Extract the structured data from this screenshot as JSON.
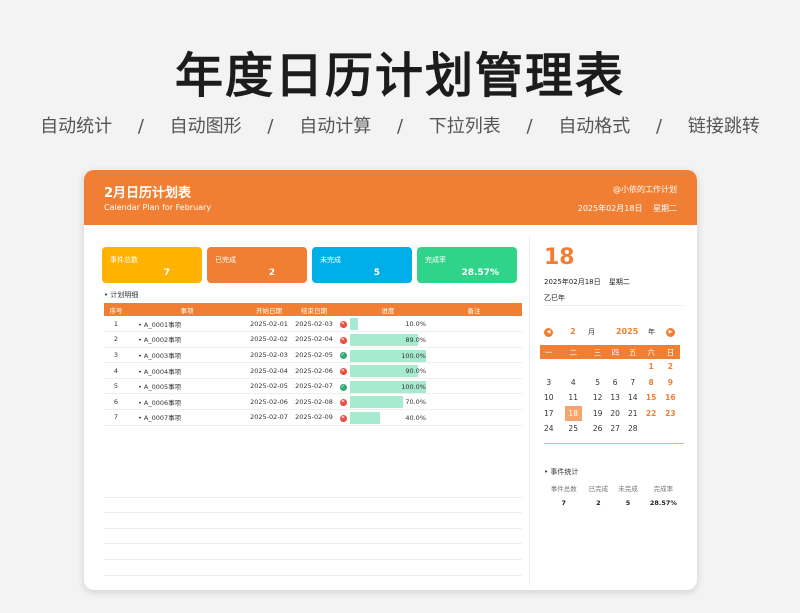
{
  "header": {
    "title": "年度日历计划管理表",
    "features": [
      "自动统计",
      "/",
      "自动图形",
      "/",
      "自动计算",
      "/",
      "下拉列表",
      "/",
      "自动格式",
      "/",
      "链接跳转"
    ]
  },
  "banner": {
    "title": "2月日历计划表",
    "subtitle": "Calendar Plan for February",
    "right_top": "@小依的工作计划",
    "right_bottom": "2025年02月18日    星期二"
  },
  "stats": [
    {
      "label": "事件总数",
      "value": "7",
      "color": "#ffb300"
    },
    {
      "label": "已完成",
      "value": "2",
      "color": "#f07f33"
    },
    {
      "label": "未完成",
      "value": "5",
      "color": "#00aee8"
    },
    {
      "label": "完成率",
      "value": "28.57%",
      "color": "#2fd48a"
    }
  ],
  "plan": {
    "section_label": "计划明细",
    "columns": [
      "序号",
      "事项",
      "开始日期",
      "结束日期",
      "进度",
      "",
      "备注"
    ],
    "rows": [
      {
        "no": "1",
        "item": "A_0001事项",
        "start": "2025-02-01",
        "end": "2025-02-03",
        "status": "x",
        "progress": 0.1,
        "pct": "10.0%"
      },
      {
        "no": "2",
        "item": "A_0002事项",
        "start": "2025-02-02",
        "end": "2025-02-04",
        "status": "x",
        "progress": 0.89,
        "pct": "89.0%"
      },
      {
        "no": "3",
        "item": "A_0003事项",
        "start": "2025-02-03",
        "end": "2025-02-05",
        "status": "ok",
        "progress": 1.0,
        "pct": "100.0%"
      },
      {
        "no": "4",
        "item": "A_0004事项",
        "start": "2025-02-04",
        "end": "2025-02-06",
        "status": "x",
        "progress": 0.9,
        "pct": "90.0%"
      },
      {
        "no": "5",
        "item": "A_0005事项",
        "start": "2025-02-05",
        "end": "2025-02-07",
        "status": "ok",
        "progress": 1.0,
        "pct": "100.0%"
      },
      {
        "no": "6",
        "item": "A_0006事项",
        "start": "2025-02-06",
        "end": "2025-02-08",
        "status": "x",
        "progress": 0.7,
        "pct": "70.0%"
      },
      {
        "no": "7",
        "item": "A_0007事项",
        "start": "2025-02-07",
        "end": "2025-02-09",
        "status": "x",
        "progress": 0.4,
        "pct": "40.0%"
      }
    ]
  },
  "sidebar": {
    "big_day": "18",
    "date_text": "2025年02月18日   星期二",
    "lunar": "乙巳年",
    "nav": {
      "prev": "◀",
      "next": "▶",
      "month": "2",
      "month_unit": "月",
      "year": "2025",
      "year_unit": "年"
    },
    "weekdays": [
      "一",
      "二",
      "三",
      "四",
      "五",
      "六",
      "日"
    ],
    "weeks": [
      [
        "",
        "",
        "",
        "",
        "",
        "1",
        "2"
      ],
      [
        "3",
        "4",
        "5",
        "6",
        "7",
        "8",
        "9"
      ],
      [
        "10",
        "11",
        "12",
        "13",
        "14",
        "15",
        "16"
      ],
      [
        "17",
        "18",
        "19",
        "20",
        "21",
        "22",
        "23"
      ],
      [
        "24",
        "25",
        "26",
        "27",
        "28",
        "",
        ""
      ]
    ],
    "today": "18",
    "event_stats": {
      "title": "事件统计",
      "headers": [
        "事件总数",
        "已完成",
        "未完成",
        "完成率"
      ],
      "values": [
        "7",
        "2",
        "5",
        "28.57%"
      ]
    }
  }
}
